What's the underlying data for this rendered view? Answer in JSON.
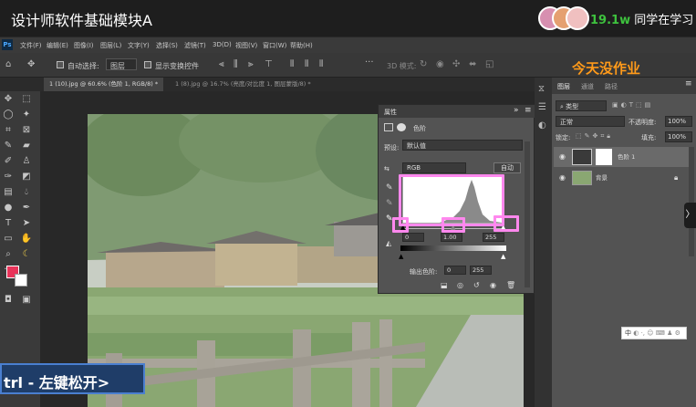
{
  "course": {
    "title": "设计师软件基础模块A",
    "viewer_count": "19.1w",
    "viewer_text": "同学在学习"
  },
  "app": {
    "logo": "Ps"
  },
  "menubar": [
    "文件(F)",
    "编辑(E)",
    "图像(I)",
    "图层(L)",
    "文字(Y)",
    "选择(S)",
    "滤镜(T)",
    "3D(D)",
    "视图(V)",
    "窗口(W)",
    "帮助(H)"
  ],
  "options": {
    "auto_select_label": "自动选择:",
    "auto_select_value": "图层",
    "show_transform": "显示变换控件",
    "mode_3d": "3D 模式:"
  },
  "tabs": [
    {
      "label": "1 (10).jpg @ 60.6% (色阶 1, RGB/8) *",
      "active": true
    },
    {
      "label": "1 (8).jpg @ 16.7% (亮度/对比度 1, 图层蒙版/8) *",
      "active": false
    }
  ],
  "properties": {
    "panel_title": "属性",
    "adjustment_name": "色阶",
    "preset_label": "预设:",
    "preset_value": "默认值",
    "channel": "RGB",
    "auto_button": "自动",
    "input_black": "0",
    "input_gray": "1.00",
    "input_white": "255",
    "output_label": "输出色阶:",
    "output_black": "0",
    "output_white": "255"
  },
  "layers": {
    "tabs": [
      "图层",
      "通道",
      "路径"
    ],
    "filter_value": "类型",
    "blend_mode": "正常",
    "opacity_label": "不透明度:",
    "opacity_value": "100%",
    "lock_label": "锁定:",
    "fill_label": "填充:",
    "fill_value": "100%",
    "items": [
      {
        "name": "色阶 1"
      },
      {
        "name": "背景"
      }
    ]
  },
  "watermark": "今天没作业",
  "caption": "trl - 左键松开>",
  "ime": "中"
}
